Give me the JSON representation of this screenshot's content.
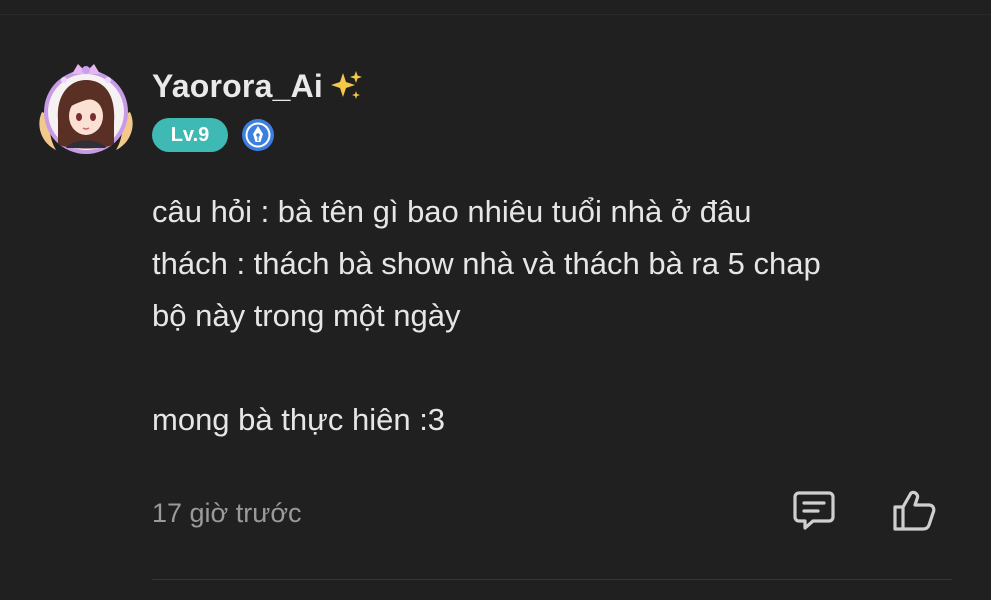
{
  "comment": {
    "author": {
      "name": "Yaorora_Ai",
      "flair_icon": "sparkles-icon",
      "level": "Lv.9",
      "badge_icon": "pen-nib-badge-icon",
      "avatar_icon": "anime-girl-avatar"
    },
    "lines": [
      "câu hỏi : bà tên gì bao nhiêu tuổi nhà ở đâu",
      "thách : thách bà show nhà và thách bà ra 5 chap",
      "bộ này trong một ngày",
      "",
      "mong bà thực hiên :3"
    ],
    "timestamp": "17 giờ trước",
    "actions": {
      "reply_icon": "comment-reply-icon",
      "like_icon": "thumbs-up-icon"
    }
  },
  "colors": {
    "background": "#202020",
    "text": "#e6e6e6",
    "muted": "#9a9a9a",
    "level_badge": "#3fb9b3",
    "badge_blue": "#3d7fe0"
  }
}
